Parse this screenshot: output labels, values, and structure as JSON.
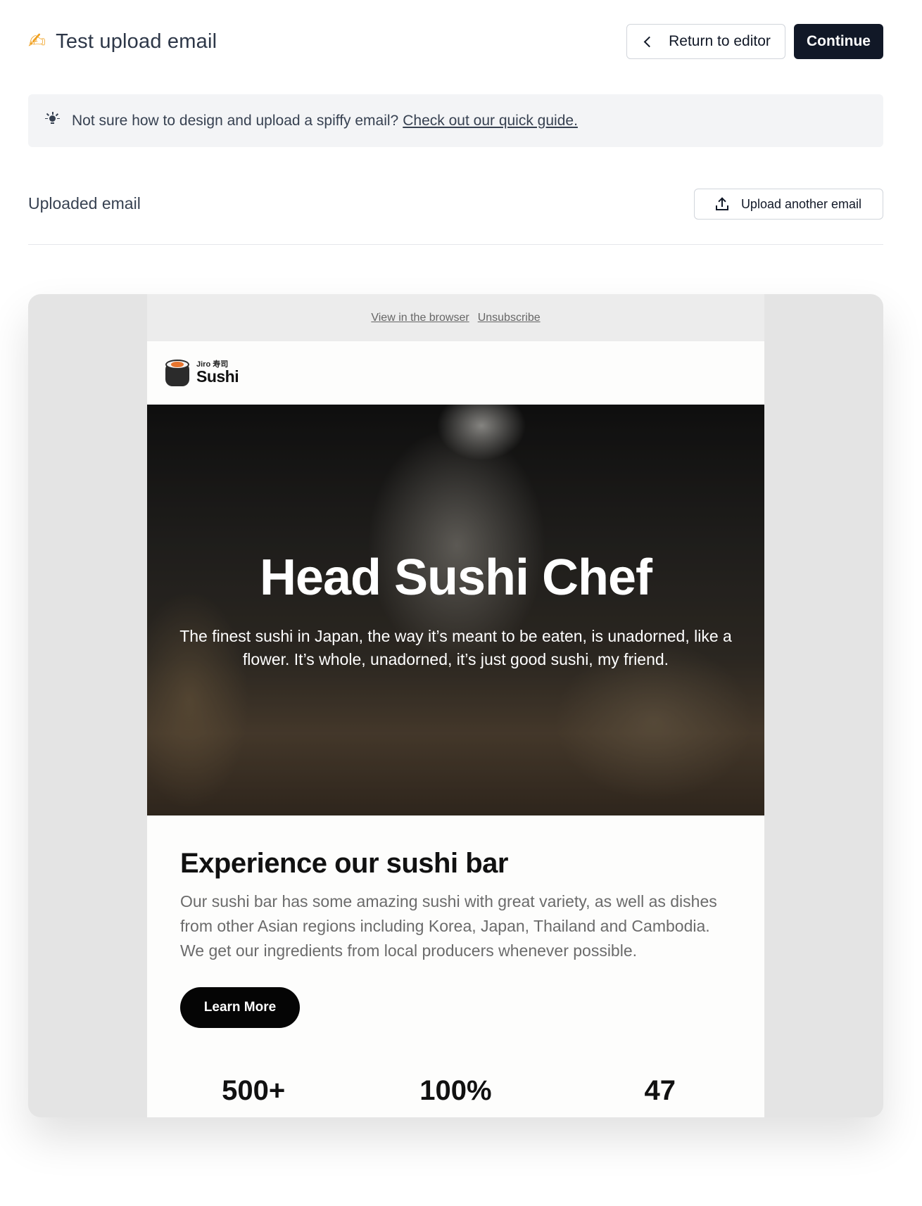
{
  "header": {
    "title_emoji": "✍",
    "title": "Test upload email",
    "return_label": "Return to editor",
    "continue_label": "Continue"
  },
  "banner": {
    "text": "Not sure how to design and upload a spiffy email?",
    "link_text": "Check out our quick guide."
  },
  "section": {
    "title": "Uploaded email",
    "upload_label": "Upload another email"
  },
  "email": {
    "view_in_browser": "View in the browser",
    "unsubscribe": "Unsubscribe",
    "logo_small": "Jiro 寿司",
    "logo_big": "Sushi",
    "hero_title": "Head Sushi Chef",
    "hero_subtitle": "The finest sushi in Japan, the way it’s meant to be eaten, is unadorned, like a flower. It’s whole, unadorned, it’s just good sushi, my friend.",
    "section_title": "Experience our sushi bar",
    "section_body": "Our sushi bar has some amazing sushi with great variety, as well as dishes from other Asian regions including Korea, Japan, Thailand and Cambodia. We get our ingredients from local producers whenever possible.",
    "cta_label": "Learn More",
    "stats": [
      "500+",
      "100%",
      "47"
    ]
  },
  "colors": {
    "primary_button": "#111827",
    "banner_bg": "#f3f4f6",
    "preview_bg": "#e4e4e4",
    "cta_bg": "#050505"
  },
  "icons": {
    "return": "chevron-left-icon",
    "banner": "lightbulb-icon",
    "upload": "upload-icon",
    "logo": "sushi-roll-icon"
  }
}
